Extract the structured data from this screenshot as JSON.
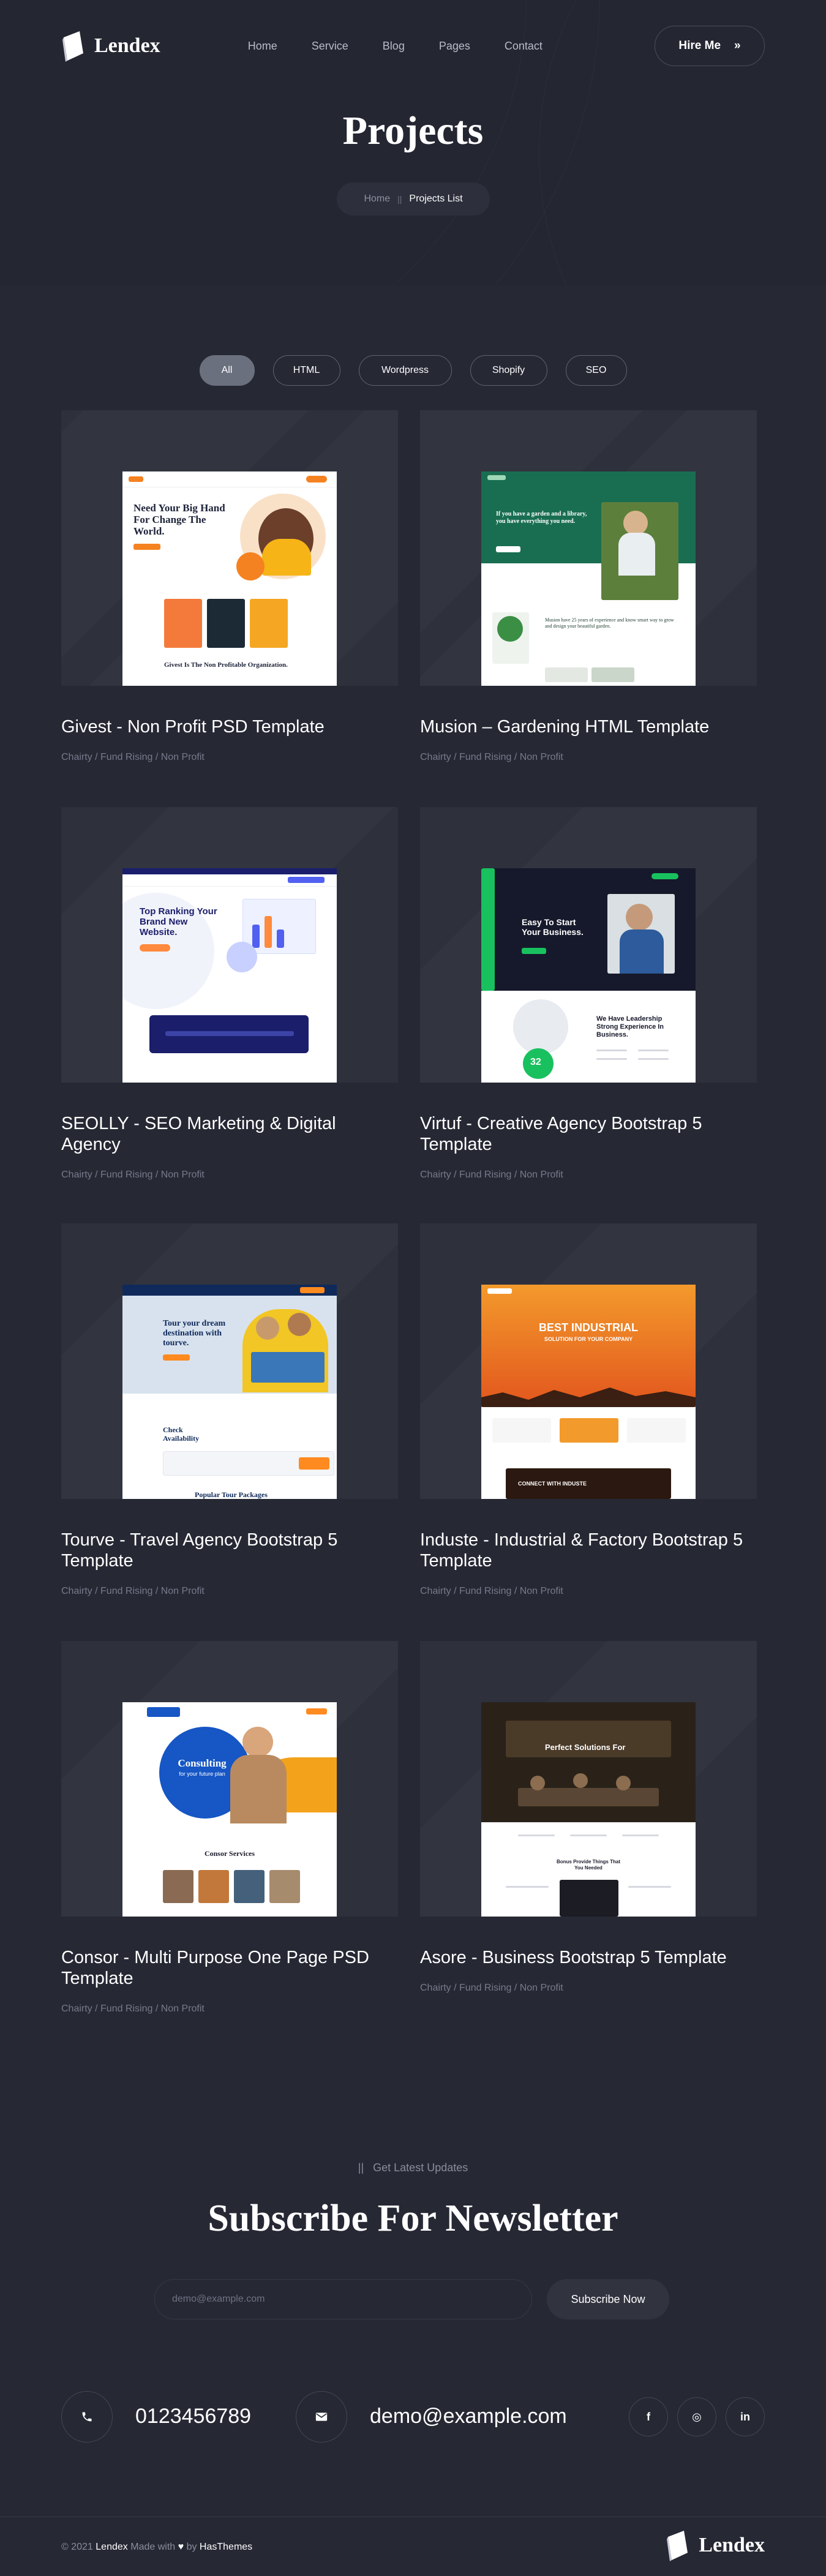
{
  "brand": {
    "name": "Lendex"
  },
  "nav": {
    "items": [
      "Home",
      "Service",
      "Blog",
      "Pages",
      "Contact"
    ],
    "hire_label": "Hire Me",
    "hire_arrow": "»"
  },
  "hero": {
    "title": "Projects",
    "breadcrumb_home": "Home",
    "breadcrumb_sep": "||",
    "breadcrumb_current": "Projects List"
  },
  "filters": [
    "All",
    "HTML",
    "Wordpress",
    "Shopify",
    "SEO"
  ],
  "projects": [
    {
      "title": "Givest - Non Profit PSD Template",
      "tags": "Chairty / Fund Rising / Non Profit"
    },
    {
      "title": "Musion – Gardening HTML Template",
      "tags": "Chairty / Fund Rising / Non Profit"
    },
    {
      "title": "SEOLLY - SEO Marketing & Digital Agency",
      "tags": "Chairty / Fund Rising / Non Profit"
    },
    {
      "title": "Virtuf - Creative Agency Bootstrap 5 Template",
      "tags": "Chairty / Fund Rising / Non Profit"
    },
    {
      "title": "Tourve - Travel Agency Bootstrap 5 Template",
      "tags": "Chairty / Fund Rising / Non Profit"
    },
    {
      "title": "Induste - Industrial & Factory Bootstrap 5 Template",
      "tags": "Chairty / Fund Rising / Non Profit"
    },
    {
      "title": "Consor - Multi Purpose One Page PSD Template",
      "tags": "Chairty / Fund Rising / Non Profit"
    },
    {
      "title": "Asore - Business Bootstrap 5 Template",
      "tags": "Chairty / Fund Rising / Non Profit"
    }
  ],
  "previews": {
    "givest": {
      "headline": "Need Your Big Hand For Change The World.",
      "sub": "Givest Is The Non Profitable Organization."
    },
    "musion": {
      "headline": "If you have a garden and a library, you have everything you need.",
      "sub": "Musion have 25 years of experience and know smart way to grow and design your beautiful garden."
    },
    "seolly": {
      "headline": "Top Ranking Your Brand New Website."
    },
    "virtuf": {
      "headline": "Easy To Start Your Business.",
      "sub": "We Have Leadership Strong Experience In Business.",
      "badge": "32"
    },
    "tourve": {
      "headline": "Tour your dream destination with tourve.",
      "sub": "Check Availability",
      "footer": "Popular Tour Packages"
    },
    "induste": {
      "headline": "BEST INDUSTRIAL",
      "sub": "SOLUTION FOR YOUR COMPANY",
      "cta": "CONNECT WITH INDUSTE"
    },
    "consor": {
      "headline": "Consulting",
      "sub": "for your future plan",
      "section": "Consor Services"
    },
    "asore": {
      "headline": "Perfect Solutions For",
      "section": "Bonus Provide Things That You Needed"
    }
  },
  "newsletter": {
    "kicker": "Get Latest Updates",
    "kicker_mark": "||",
    "title": "Subscribe For Newsletter",
    "placeholder": "demo@example.com",
    "button": "Subscribe Now"
  },
  "contact": {
    "phone": "0123456789",
    "email": "demo@example.com"
  },
  "social": [
    "f",
    "◎",
    "in"
  ],
  "footer": {
    "year_text": "© 2021",
    "brand": "Lendex",
    "made_with": "Made with",
    "heart": "♥",
    "by": "by",
    "author": "HasThemes"
  }
}
